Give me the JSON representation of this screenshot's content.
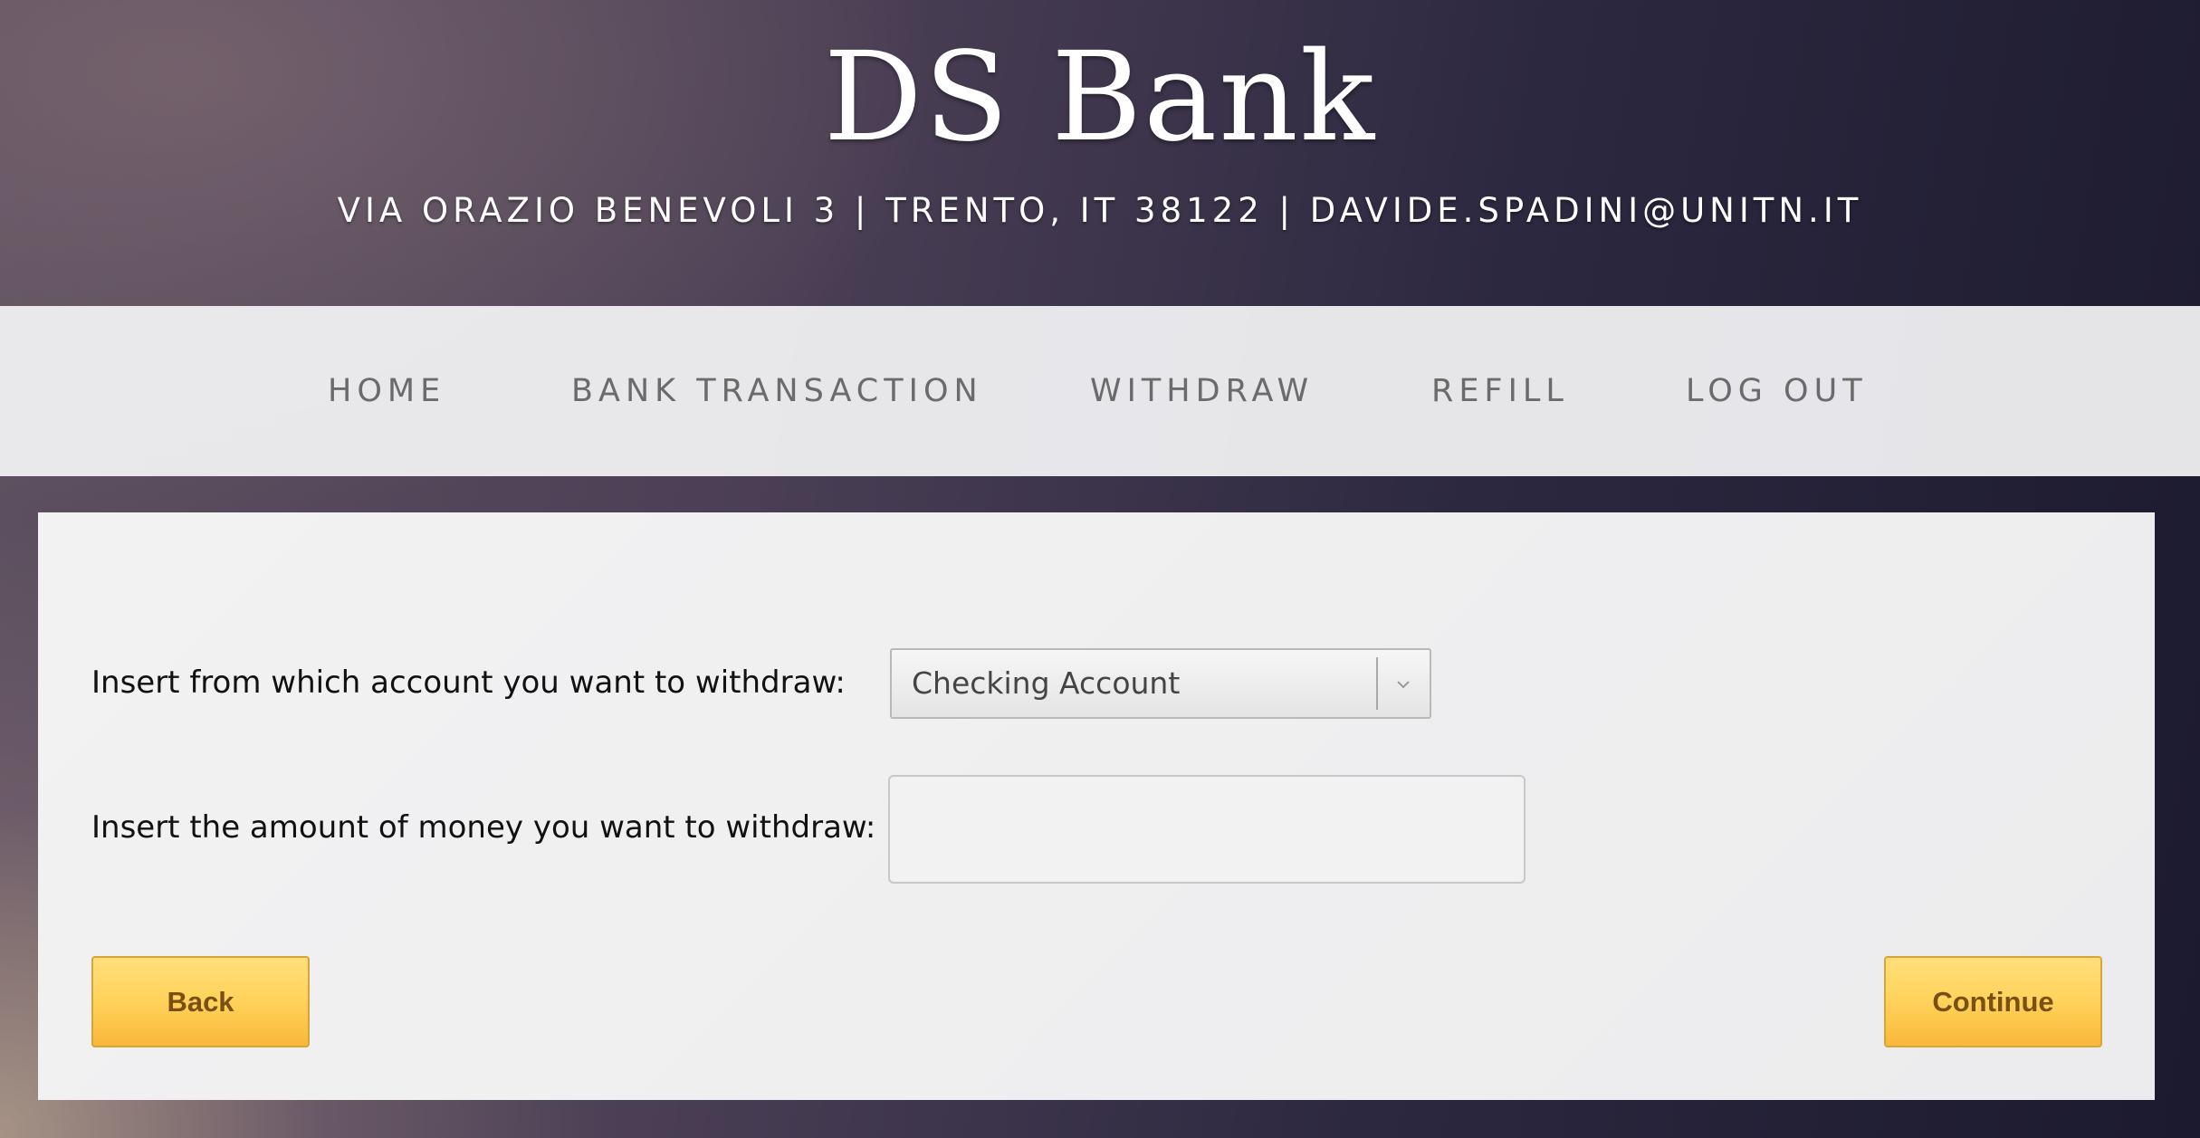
{
  "header": {
    "title": "DS Bank",
    "address": "VIA ORAZIO BENEVOLI 3 | TRENTO, IT 38122 | DAVIDE.SPADINI@UNITN.IT"
  },
  "nav": {
    "items": [
      "HOME",
      "BANK TRANSACTION",
      "WITHDRAW",
      "REFILL",
      "LOG OUT"
    ]
  },
  "form": {
    "account_label": "Insert from which account you want to withdraw:",
    "account_selected": "Checking Account",
    "amount_label": "Insert the amount of money you want to withdraw:",
    "amount_value": ""
  },
  "buttons": {
    "back": "Back",
    "continue": "Continue"
  },
  "colors": {
    "button_gradient_top": "#ffdf7a",
    "button_gradient_bottom": "#f8b83a",
    "button_text": "#7a4f14",
    "nav_background": "#f0f0f2",
    "nav_text": "#6b6b6b"
  },
  "icons": {
    "select_arrow": "chevron-down-icon"
  }
}
